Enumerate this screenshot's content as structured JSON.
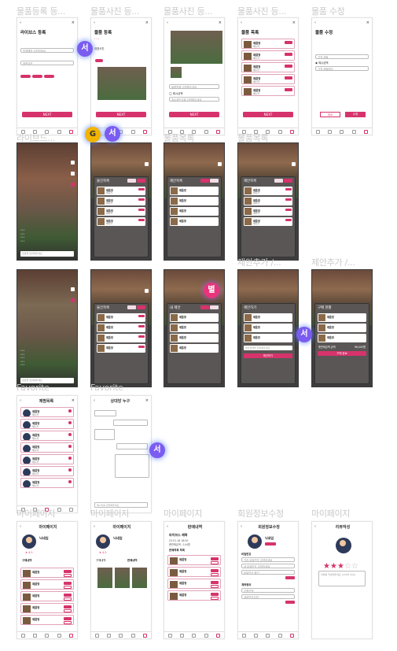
{
  "sections": {
    "s1": "물품등록 등...",
    "s2": "물품사진 등...",
    "s3": "물품사진 등...",
    "s4": "물품사진 등...",
    "s5": "물품 수정",
    "s6": "라이브드...",
    "s7": "물품목록",
    "s8": "물품목록",
    "s9": "물품목록",
    "s10": "제안추가 /...",
    "s11": "제안추가 /...",
    "s12": "Favorite",
    "s13": "Favorite",
    "s14": "마이페이지",
    "s15": "마이페이지",
    "s16": "마이페이지",
    "s17": "회원정보수정",
    "s18": "마이페이지"
  },
  "screens": {
    "license_title": "라이브스 등록",
    "license_field": "판매예방 입력하세요",
    "license_field2": "제목입력",
    "next": "NEXT",
    "item_reg_title": "물품 등록",
    "item_reg_sub": "대표사진",
    "item_photo_field": "물품명을 입력해주세요",
    "item_photo_check": "제시금액",
    "item_photo_field2": "최소제안금을 입력해주세요",
    "item_list_title": "물품 목록",
    "item_edit_title": "물품 수정",
    "item_edit_field": "가격 제출",
    "item_edit_check": "제시금액",
    "item_edit_field2": "가격 제출해주",
    "cancel": "취소",
    "edit": "수정",
    "product": "제품명",
    "price": "제시가",
    "sheet_list": "물건목록",
    "sheet_offer": "제안목록",
    "sheet_mine": "내 제안",
    "sheet_add": "제안하기",
    "sheet_buy": "구매 현황",
    "submit_offer": "제안하기",
    "buy_done": "구매 완료",
    "offer_input": "제안금액을 입력해주세요",
    "total": "총판매금액 금액",
    "total_val": "96,000원",
    "chat_title": "상대방 누구",
    "chat_input": "메시지를 입력해주세요",
    "fav_title": "제찜목록",
    "my_title": "마이페이지",
    "nickname": "닉네임",
    "rating": "4.5",
    "sell_tab": "구매내역",
    "buy_tab": "판매내역",
    "history_title": "판매내역",
    "live_title": "라이브스 제목",
    "live_date": "23.01.18 18:00",
    "live_total": "총판매금액 : 144원",
    "sold_list": "판매목록 목록",
    "profile_title": "회원정보수정",
    "nick_label": "비밀번호",
    "pw_field1": "기존 비밀번호 입력하세요",
    "pw_field2": "새 비밀번호 입력하세요",
    "pw_field3": "비밀번호 확인",
    "account_label": "계좌정보",
    "bank_field": "은행선택",
    "acct_field": "계좌번호입력",
    "review_title": "리뷰작성",
    "review_field": "리뷰를 작성해주세요 (200자 이내)",
    "comment": "댓글을 입력해주세요"
  },
  "bubbles": {
    "b1": "서",
    "b2": "G",
    "b3": "서",
    "b4": "별",
    "b5": "서",
    "b6": "서"
  },
  "colors": {
    "accent": "#d6336c",
    "bubble_purple": "#7b5cf0",
    "bubble_gold": "#f2b400"
  }
}
